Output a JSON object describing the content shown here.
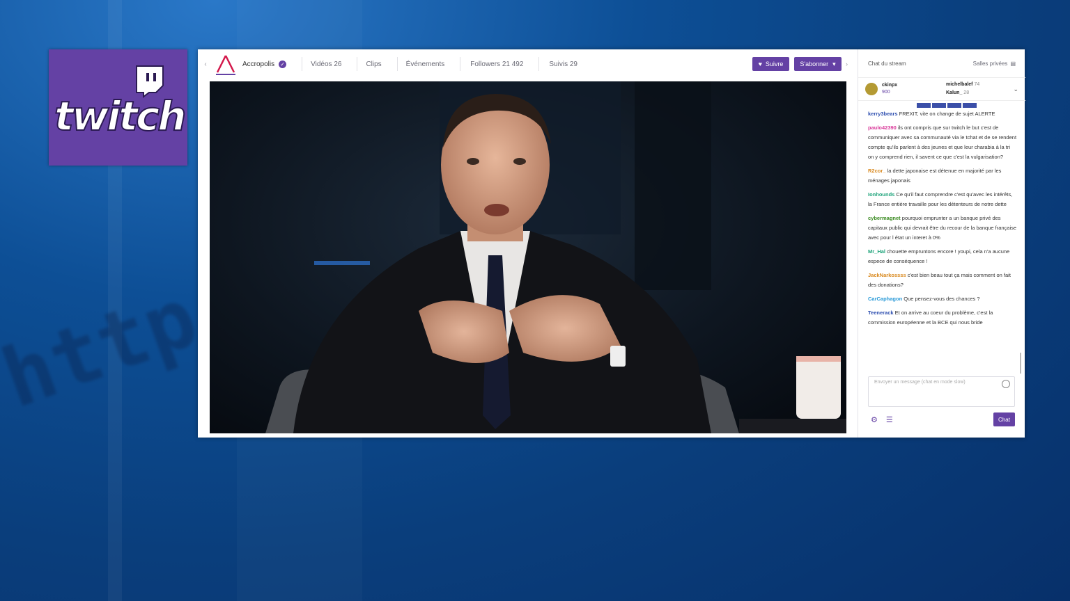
{
  "background": {
    "url_text": "http://ww"
  },
  "logo": {
    "text": "twitch",
    "color": "#6441a4"
  },
  "channel": {
    "name": "Accropolis",
    "verified_icon": "verified-check-icon"
  },
  "nav": {
    "videos": "Vidéos 26",
    "clips": "Clips",
    "events": "Événements",
    "followers": "Followers 21 492",
    "following": "Suivis 29"
  },
  "actions": {
    "follow": "Suivre",
    "subscribe": "S'abonner"
  },
  "chat": {
    "title": "Chat du stream",
    "rooms": "Salles privées",
    "top_left": {
      "name": "ckinpx",
      "amount": "900"
    },
    "top_right": [
      {
        "name": "michelbalef",
        "amount": "74"
      },
      {
        "name": "Kalun_",
        "amount": "28"
      }
    ],
    "messages": [
      {
        "user": "kerry3bears",
        "color": "#2e4fb0",
        "text": " FREXIT, vite on change de sujet ALERTE"
      },
      {
        "user": "paulo42390",
        "color": "#d93a9a",
        "text": " ils ont compris que sur twitch le but c'est de communiquer avec sa communauté via le tchat et de se rendent compte qu'ils parlent à des jeunes et que leur charabia à la tri on y comprend rien, il savent ce que c'est la vulgarisation?"
      },
      {
        "user": "R2cor_",
        "color": "#d98a20",
        "text": " la dette japonaise est détenue en majorité par les ménages japonais"
      },
      {
        "user": "Ionhounds",
        "color": "#1ea37a",
        "text": " Ce qu'il faut comprendre c'est qu'avec les intérêts, la France entière travaille pour les détenteurs de notre dette"
      },
      {
        "user": "cybermagnet",
        "color": "#3a8a20",
        "text": " pourquoi emprunter a un banque privé des capitaux public qui devrait être du recour de la banque française avec pour l état un interet à 0%"
      },
      {
        "user": "Mr_Hal",
        "color": "#1ea37a",
        "text": " chouette empruntons encore ! youpi, cela n'a aucune espece de conséquence !"
      },
      {
        "user": "JackNarkossss",
        "color": "#d98a20",
        "text": " c'est bien beau tout ça mais comment on fait des donations?"
      },
      {
        "user": "CarCaphagon",
        "color": "#2a9ad8",
        "text": " Que pensez-vous des chances ?"
      },
      {
        "user": "Teenerack",
        "color": "#2e4fb0",
        "text": " Et on arrive au coeur du problème, c'est la commission européenne et la BCE qui nous bride"
      }
    ],
    "input_placeholder": "Envoyer un message (chat en mode slow)",
    "send": "Chat"
  }
}
